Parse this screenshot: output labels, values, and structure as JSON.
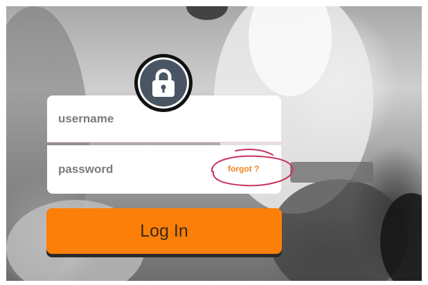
{
  "login": {
    "username_placeholder": "username",
    "password_placeholder": "password",
    "forgot_link": "forgot ?",
    "login_button": "Log In"
  },
  "icons": {
    "lock": "lock-icon"
  },
  "colors": {
    "accent": "#fb7f08",
    "forgot_link": "#f0821e",
    "lock_circle": "#4a5564",
    "annotation": "#c8325a"
  }
}
